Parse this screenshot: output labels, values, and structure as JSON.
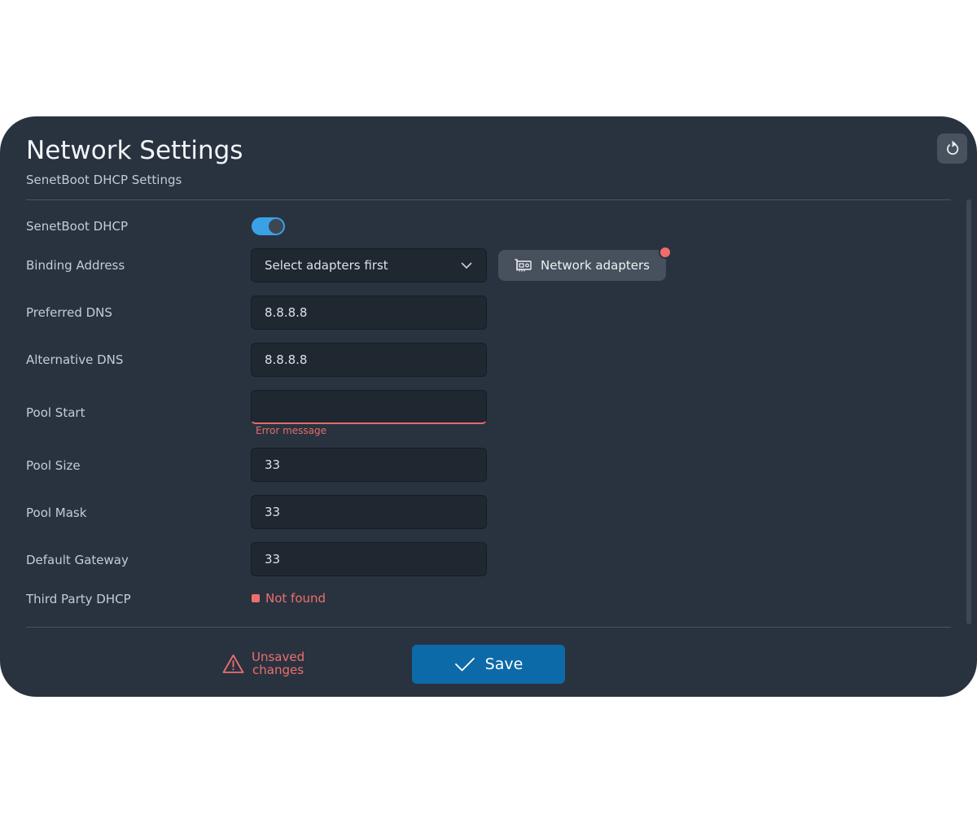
{
  "header": {
    "title": "Network Settings",
    "subtitle": "SenetBoot DHCP Settings",
    "reset_icon": "reset-icon"
  },
  "form": {
    "senetboot_dhcp": {
      "label": "SenetBoot DHCP",
      "enabled": true
    },
    "binding_address": {
      "label": "Binding Address",
      "value": "Select adapters first",
      "button_label": "Network adapters",
      "button_icon": "network-card-icon",
      "has_notification": true
    },
    "preferred_dns": {
      "label": "Preferred DNS",
      "value": "8.8.8.8"
    },
    "alternative_dns": {
      "label": "Alternative DNS",
      "value": "8.8.8.8"
    },
    "pool_start": {
      "label": "Pool Start",
      "value": "",
      "error": "Error message"
    },
    "pool_size": {
      "label": "Pool Size",
      "value": "33"
    },
    "pool_mask": {
      "label": "Pool Mask",
      "value": "33"
    },
    "default_gateway": {
      "label": "Default Gateway",
      "value": "33"
    },
    "third_party_dhcp": {
      "label": "Third Party DHCP",
      "status": "Not found"
    }
  },
  "footer": {
    "unsaved_line1": "Unsaved",
    "unsaved_line2": "changes",
    "save_label": "Save"
  },
  "colors": {
    "panel_bg": "#29333f",
    "field_bg": "#1f2731",
    "accent": "#3ba1e6",
    "save_bg": "#0d6aa8",
    "error": "#ee6e6e"
  }
}
